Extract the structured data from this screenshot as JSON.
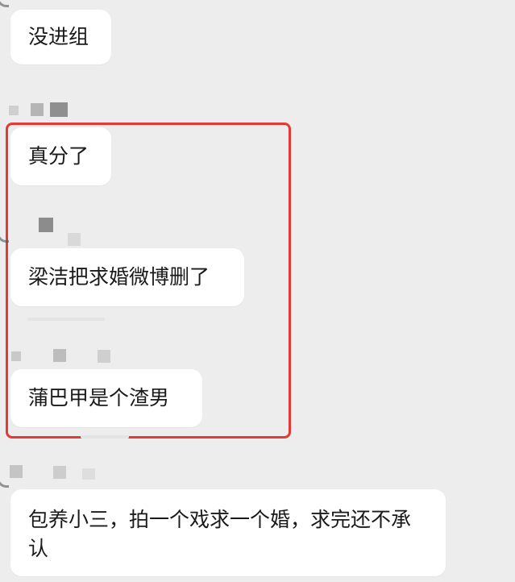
{
  "messages": [
    {
      "text": "没进组"
    },
    {
      "text": "真分了"
    },
    {
      "text": "梁洁把求婚微博删了"
    },
    {
      "text": "蒲巴甲是个渣男"
    },
    {
      "text": "包养小三，拍一个戏求一个婚，求完还不承认"
    }
  ],
  "annotation": {
    "color": "#e53935"
  },
  "colors": {
    "background": "#ededed",
    "bubble": "#ffffff",
    "mosaic": [
      "#8c8c8c",
      "#c9c9c9",
      "#d9d9d9"
    ]
  }
}
